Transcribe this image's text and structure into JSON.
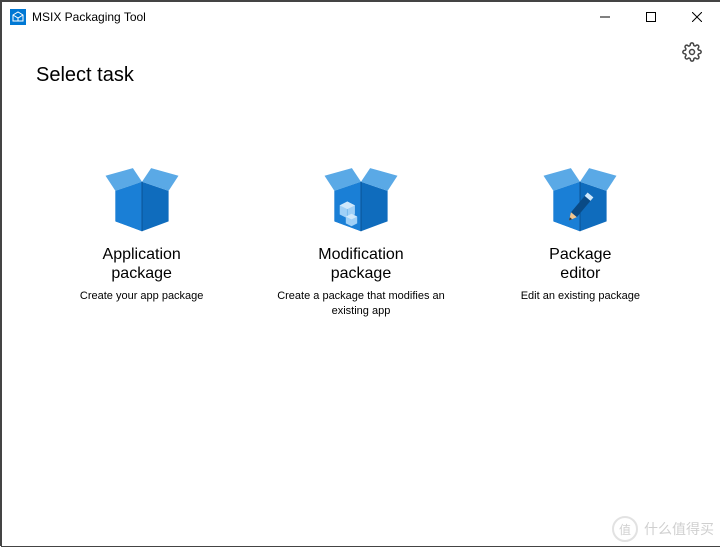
{
  "window": {
    "title": "MSIX Packaging Tool"
  },
  "page": {
    "heading": "Select task"
  },
  "tasks": [
    {
      "title": "Application\npackage",
      "desc": "Create your app package"
    },
    {
      "title": "Modification\npackage",
      "desc": "Create a package that modifies an existing app"
    },
    {
      "title": "Package\neditor",
      "desc": "Edit an existing package"
    }
  ],
  "watermark": {
    "circle": "值",
    "text": "什么值得买"
  },
  "colors": {
    "accent": "#0f6cbd"
  }
}
